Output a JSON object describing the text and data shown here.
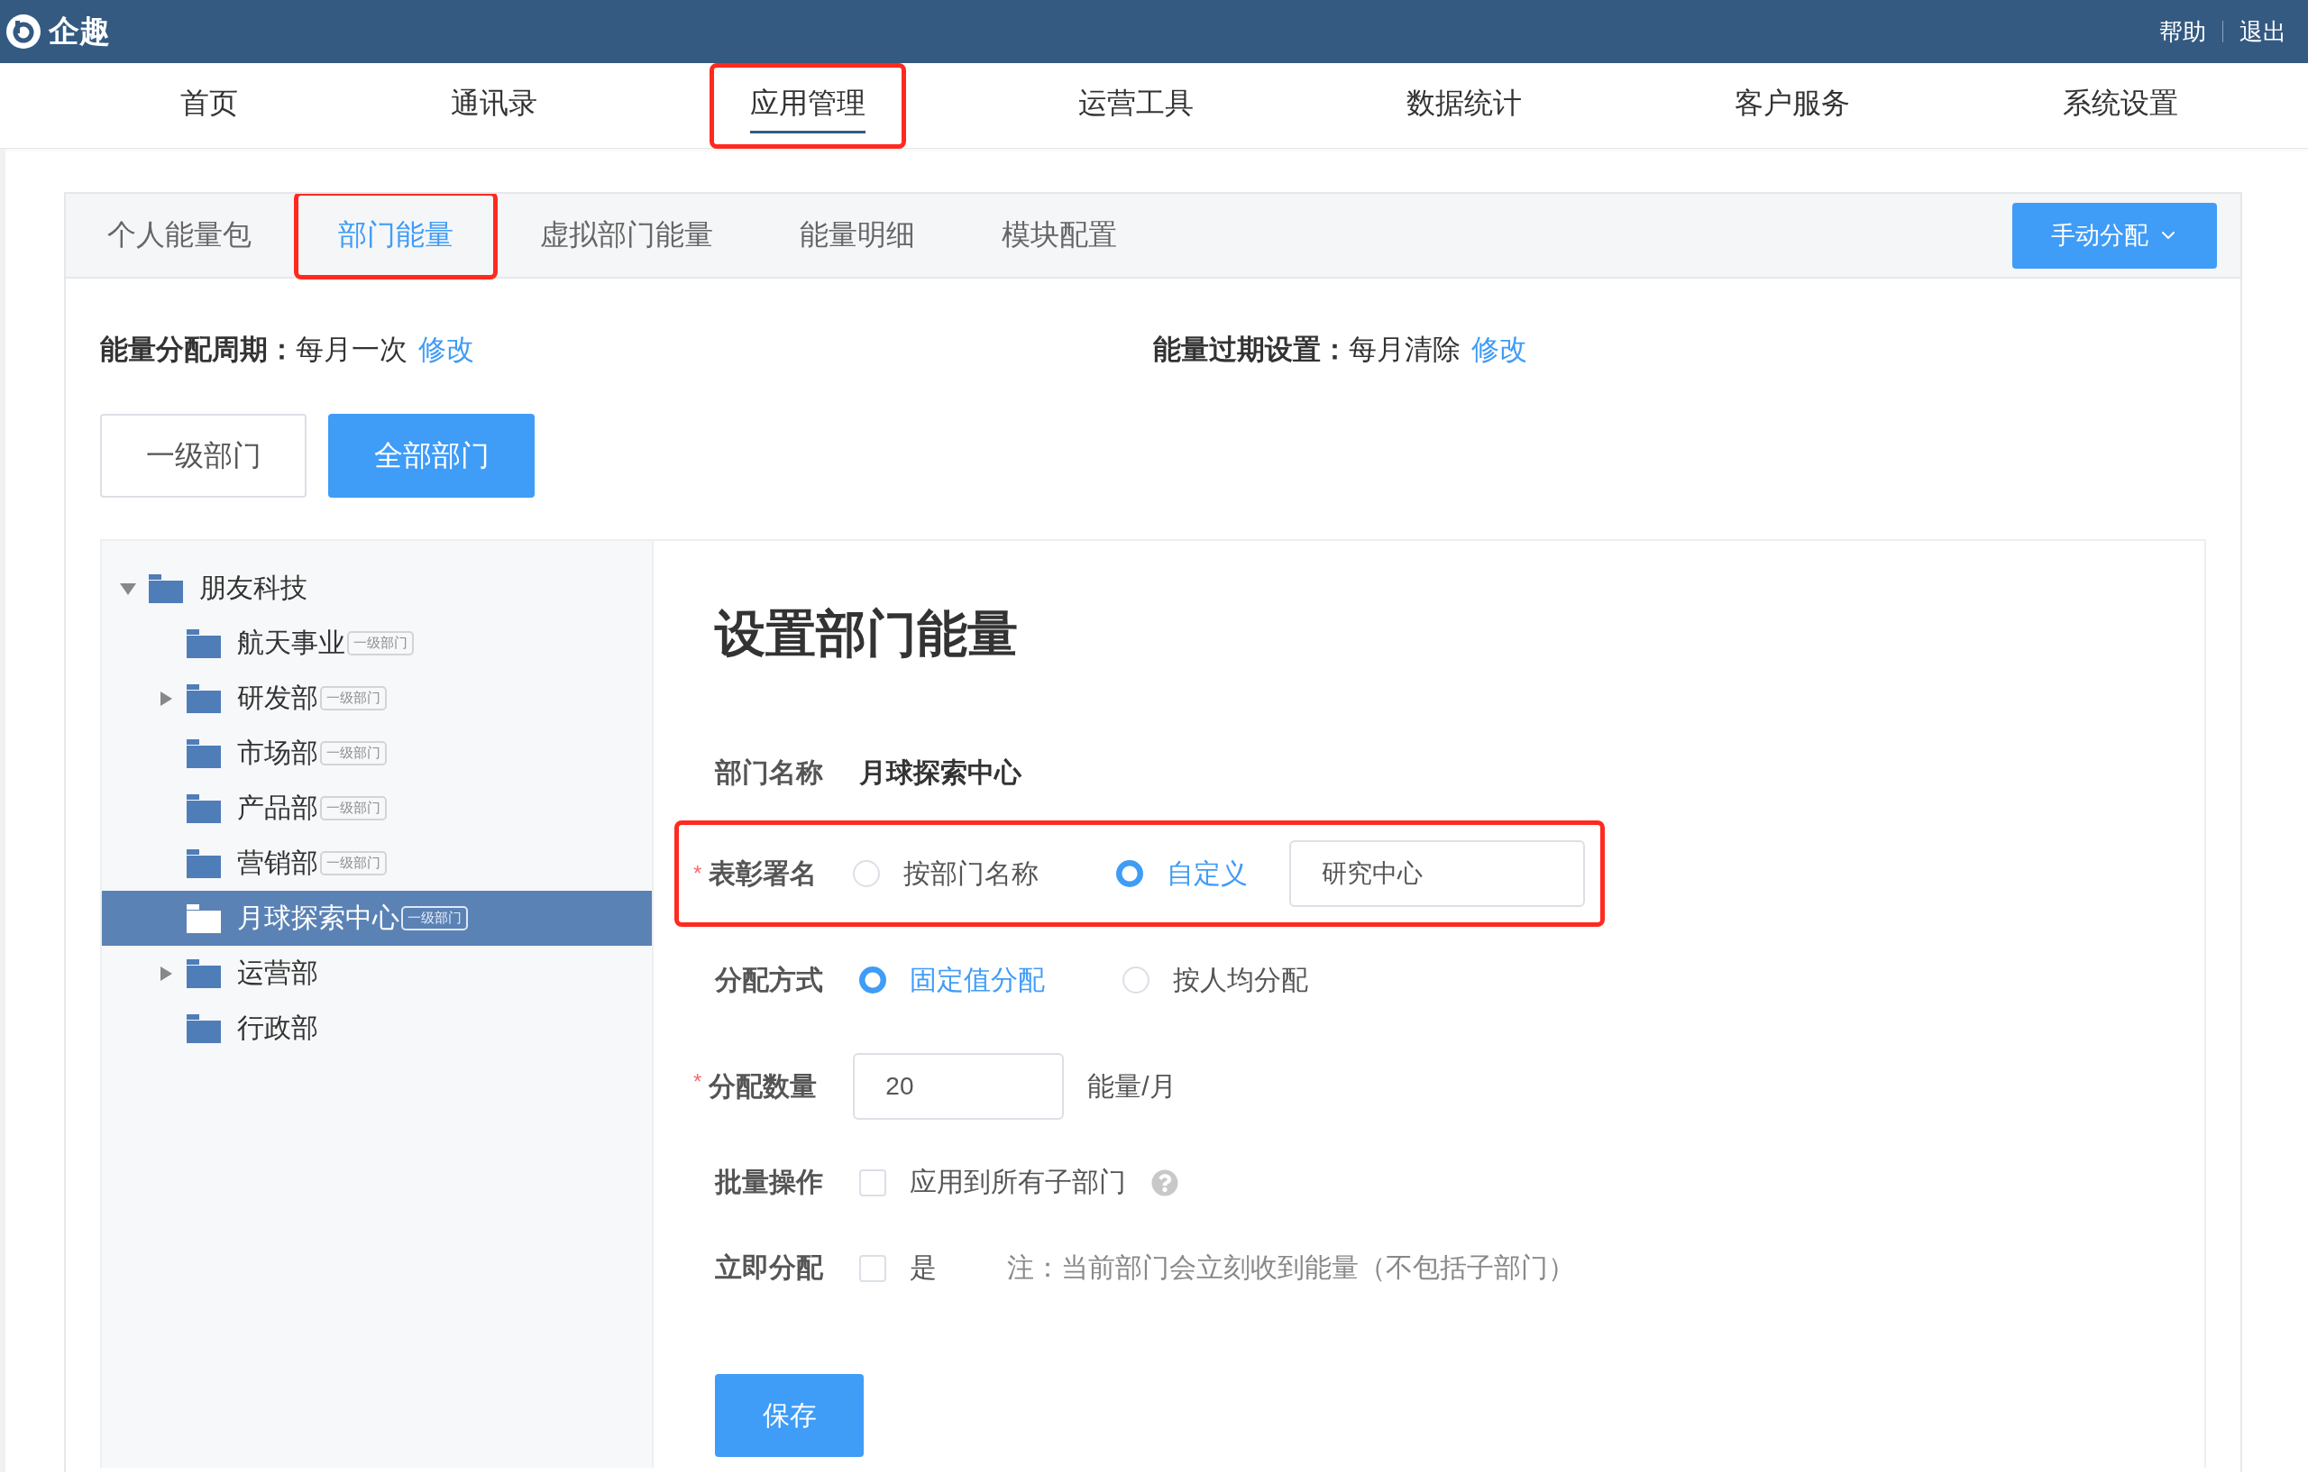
{
  "header": {
    "logo_text": "企趣",
    "links": [
      "帮助",
      "退出"
    ]
  },
  "nav": [
    {
      "label": "首页",
      "selected": false,
      "annotated": false
    },
    {
      "label": "通讯录",
      "selected": false,
      "annotated": false
    },
    {
      "label": "应用管理",
      "selected": true,
      "annotated": true
    },
    {
      "label": "运营工具",
      "selected": false,
      "annotated": false
    },
    {
      "label": "数据统计",
      "selected": false,
      "annotated": false
    },
    {
      "label": "客户服务",
      "selected": false,
      "annotated": false
    },
    {
      "label": "系统设置",
      "selected": false,
      "annotated": false
    }
  ],
  "tabs": [
    {
      "label": "个人能量包",
      "selected": false,
      "annotated": false
    },
    {
      "label": "部门能量",
      "selected": true,
      "annotated": true
    },
    {
      "label": "虚拟部门能量",
      "selected": false,
      "annotated": false
    },
    {
      "label": "能量明细",
      "selected": false,
      "annotated": false
    },
    {
      "label": "模块配置",
      "selected": false,
      "annotated": false
    }
  ],
  "action_button": "手动分配",
  "settings": [
    {
      "label": "能量分配周期：",
      "value": "每月一次",
      "link": "修改"
    },
    {
      "label": "能量过期设置：",
      "value": "每月清除",
      "link": "修改"
    }
  ],
  "scope_buttons": [
    {
      "label": "一级部门",
      "selected": false
    },
    {
      "label": "全部部门",
      "selected": true
    }
  ],
  "tree": {
    "name": "朋友科技",
    "expanded": true,
    "selected": false,
    "children": [
      {
        "name": "航天事业",
        "tag": "一级部门",
        "selected": false
      },
      {
        "name": "研发部",
        "tag": "一级部门",
        "expanded": false,
        "selected": false
      },
      {
        "name": "市场部",
        "tag": "一级部门",
        "selected": false
      },
      {
        "name": "产品部",
        "tag": "一级部门",
        "selected": false
      },
      {
        "name": "营销部",
        "tag": "一级部门",
        "selected": false
      },
      {
        "name": "月球探索中心",
        "tag": "一级部门",
        "selected": true
      },
      {
        "name": "运营部",
        "expanded": false,
        "selected": false
      },
      {
        "name": "行政部",
        "selected": false
      }
    ]
  },
  "form": {
    "title": "设置部门能量",
    "rows": [
      {
        "kind": "text",
        "label": "部门名称",
        "annotated": false,
        "value": "月球探索中心"
      },
      {
        "kind": "radio",
        "label": "表彰署名",
        "required_mark": "*",
        "annotated": true,
        "options": [
          {
            "label": "按部门名称",
            "selected": false
          },
          {
            "label": "自定义",
            "selected": true
          }
        ],
        "input_value": "研究中心"
      },
      {
        "kind": "radio",
        "label": "分配方式",
        "annotated": false,
        "options": [
          {
            "label": "固定值分配",
            "selected": true
          },
          {
            "label": "按人均分配",
            "selected": false
          }
        ]
      },
      {
        "kind": "number",
        "label": "分配数量",
        "required_mark": "*",
        "annotated": false,
        "input_value": "20",
        "unit": "能量/月"
      },
      {
        "kind": "checkbox",
        "label": "批量操作",
        "annotated": false,
        "option": "应用到所有子部门",
        "checked": false,
        "help": true
      },
      {
        "kind": "checkbox",
        "label": "立即分配",
        "annotated": false,
        "option": "是",
        "checked": false,
        "note": "注：当前部门会立刻收到能量（不包括子部门）"
      }
    ],
    "submit": "保存"
  }
}
